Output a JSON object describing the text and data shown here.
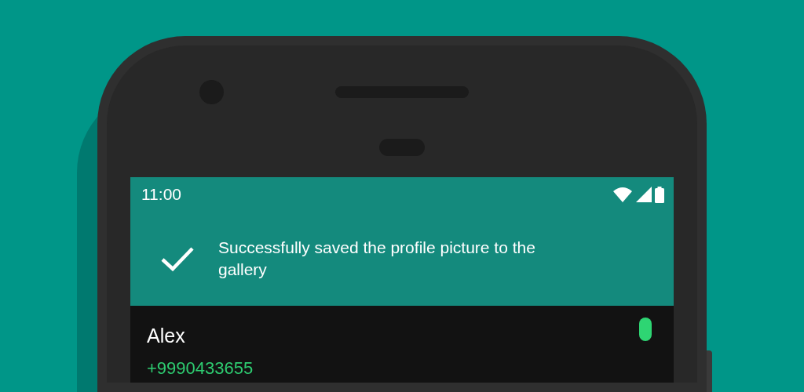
{
  "status_bar": {
    "time": "11:00"
  },
  "toast": {
    "message": "Successfully saved the profile picture to the gallery"
  },
  "contact": {
    "name": "Alex",
    "phone": "+9990433655"
  }
}
